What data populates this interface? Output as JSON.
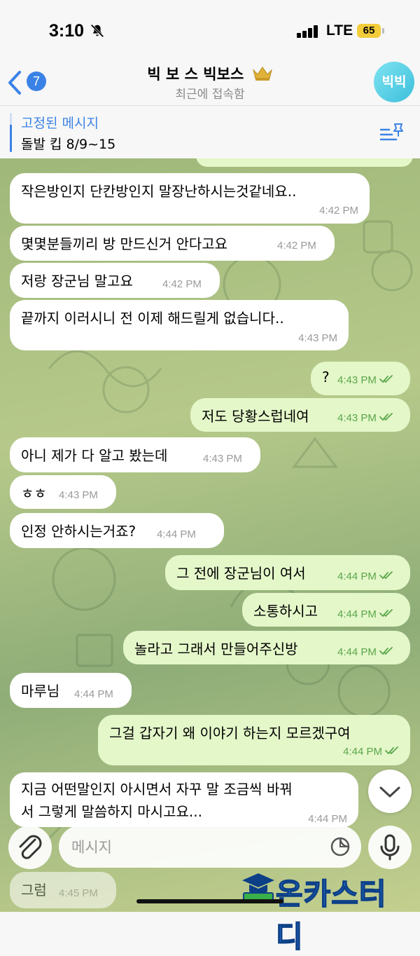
{
  "status_bar": {
    "time": "3:10",
    "network": "LTE",
    "battery": "65"
  },
  "header": {
    "back_count": "7",
    "title": "빅 보 스 빅보스",
    "subtitle": "최근에 접속함",
    "avatar_text": "빅빅"
  },
  "pinned": {
    "title": "고정된 메시지",
    "text": "돌발 킵 8/9~15"
  },
  "messages": [
    {
      "dir": "in",
      "text": "작은방인지  단칸방인지 말장난하시는것같네요..",
      "time": "4:42 PM"
    },
    {
      "dir": "in",
      "text": "몇몇분들끼리 방 만드신거 안다고요",
      "time": "4:42 PM"
    },
    {
      "dir": "in",
      "text": "저랑 장군님 말고요",
      "time": "4:42 PM"
    },
    {
      "dir": "in",
      "text": "끝까지 이러시니 전 이제 해드릴게 없습니다..",
      "time": "4:43 PM"
    },
    {
      "dir": "out",
      "text": "?",
      "time": "4:43 PM"
    },
    {
      "dir": "out",
      "text": "저도 당황스럽네여",
      "time": "4:43 PM"
    },
    {
      "dir": "in",
      "text": "아니 제가 다 알고 봤는데",
      "time": "4:43 PM"
    },
    {
      "dir": "in",
      "text": "ㅎㅎ",
      "time": "4:43 PM"
    },
    {
      "dir": "in",
      "text": "인정 안하시는거죠?",
      "time": "4:44 PM"
    },
    {
      "dir": "out",
      "text": "그 전에 장군님이 여서",
      "time": "4:44 PM"
    },
    {
      "dir": "out",
      "text": "소통하시고",
      "time": "4:44 PM"
    },
    {
      "dir": "out",
      "text": "놀라고 그래서 만들어주신방",
      "time": "4:44 PM"
    },
    {
      "dir": "in",
      "text": "마루님",
      "time": "4:44 PM"
    },
    {
      "dir": "out",
      "text": "그걸 갑자기 왜 이야기 하는지 모르겠구여",
      "time": "4:44 PM"
    },
    {
      "dir": "in",
      "text": "지금 어떤말인지 아시면서 자꾸 말 조금씩 바꿔",
      "text2": "서 그렇게 말씀하지 마시고요...",
      "time": "4:44 PM"
    },
    {
      "dir": "in",
      "text": "그럼",
      "time": "4:45 PM"
    }
  ],
  "input": {
    "placeholder": "메시지"
  },
  "watermark": "온카스터디"
}
